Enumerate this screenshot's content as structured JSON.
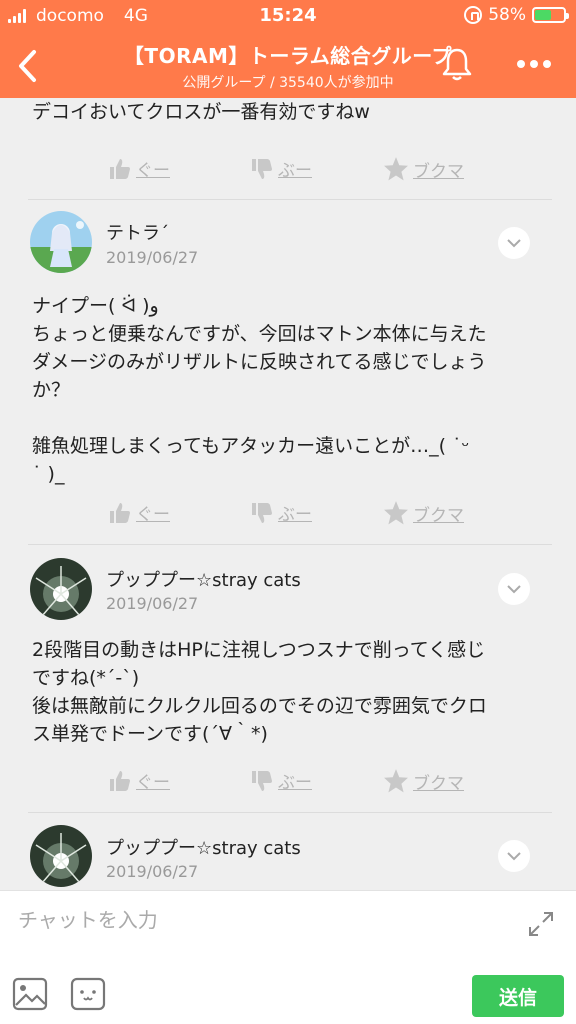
{
  "status_bar": {
    "carrier": "docomo",
    "network": "4G",
    "time": "15:24",
    "battery": "58%",
    "battery_level": 0.58,
    "battery_color": "#4cd964"
  },
  "header": {
    "title": "【TORAM】トーラム総合グループ",
    "subtitle": "公開グループ / 35540人が参加中",
    "accent_color": "#ff7a4a",
    "back_icon": "chevron-left-icon",
    "bell_icon": "bell-icon",
    "more_icon": "more-dots-icon"
  },
  "actions_labels": {
    "good": "ぐー",
    "bad": "ぶー",
    "bookmark": "ブクマ"
  },
  "messages": [
    {
      "text": "デコイおいてクロスが一番有効ですねw"
    },
    {
      "user": "テトラ´",
      "date": "2019/06/27",
      "text": "ナイプー( ᐛ )و\nちょっと便乗なんですが、今回はマトン本体に与えた\nダメージのみがリザルトに反映されてる感じでしょう\nか？\n\n雑魚処理しまくってもアタッカー遠いことが…_( ˙ᵕ\n˙ )_"
    },
    {
      "user": "プッププー☆stray cats",
      "date": "2019/06/27",
      "text": "2段階目の動きはHPに注視しつつスナで削ってく感じ\nですね(*´-`)\n後は無敵前にクルクル回るのでその辺で雰囲気でクロ\nス単発でドーンです(´∀｀*)"
    },
    {
      "user": "プッププー☆stray cats",
      "date": "2019/06/27"
    }
  ],
  "input": {
    "placeholder": "チャットを入力",
    "value": "",
    "send_label": "送信",
    "send_color": "#3cc85c"
  }
}
